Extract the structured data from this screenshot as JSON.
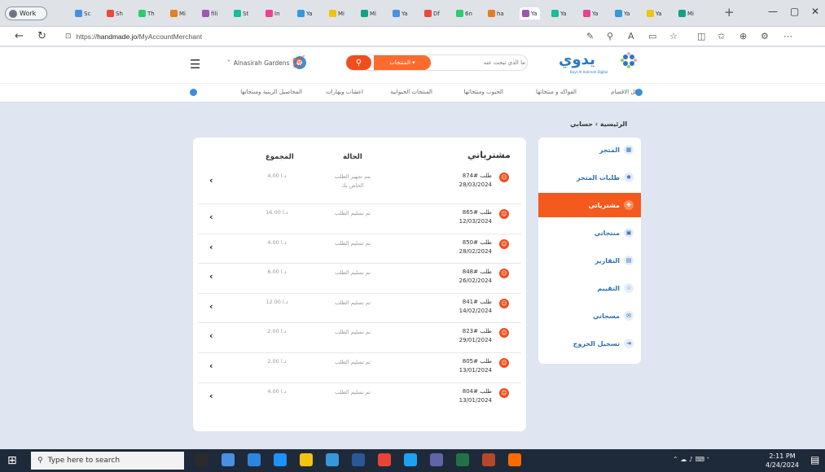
{
  "browser": {
    "profile": "Work",
    "tabs": [
      "Sc",
      "Sh",
      "Th",
      "Mi",
      "fili",
      "St",
      "In",
      "Ya",
      "Mi",
      "Mi",
      "Ya",
      "Df",
      "6n",
      "ha",
      "Ya",
      "Ya",
      "Ya",
      "Ya",
      "Ya",
      "Mi"
    ],
    "active_tab": "Ya",
    "url_prefix": "https://",
    "url_host": "handmade.jo",
    "url_path": "/MyAccountMerchant",
    "window_controls": [
      "—",
      "▢",
      "✕"
    ]
  },
  "header": {
    "account_name": "Alnasirah Gardens",
    "products_dropdown": "المنتجات ▾",
    "search_placeholder": "ما الذي تبحث عنه",
    "logo_text": "يدوي",
    "logo_sub": "Bayt Al Hekmah Digital"
  },
  "categories": [
    "كل الاقسام",
    "الفواكه و منتجاتها",
    "الحبوب ومنتجاتها",
    "المنتجات الحيوانية",
    "اعشاب وبهارات",
    "المحاصيل الزيتية ومنتجاتها"
  ],
  "breadcrumb": "الرئيسية › حسابي",
  "sidebar": [
    {
      "label": "المتجر",
      "icon": "store-icon",
      "glyph": "▦"
    },
    {
      "label": "طلبات المتجر",
      "icon": "cart-icon",
      "glyph": "✱"
    },
    {
      "label": "مشترياتي",
      "icon": "bag-icon",
      "glyph": "✚",
      "active": true
    },
    {
      "label": "منتجاتي",
      "icon": "box-icon",
      "glyph": "▣"
    },
    {
      "label": "التقارير",
      "icon": "report-icon",
      "glyph": "▤"
    },
    {
      "label": "التقييم",
      "icon": "star-icon",
      "glyph": "☆"
    },
    {
      "label": "مسجاتي",
      "icon": "mail-icon",
      "glyph": "✉"
    },
    {
      "label": "تسجيل الخروج",
      "icon": "logout-icon",
      "glyph": "⇥"
    }
  ],
  "orders": {
    "title": "مشترياتي",
    "col_status": "الحالة",
    "col_total": "المجموع",
    "rows": [
      {
        "number": "طلب #874",
        "date": "28/03/2024",
        "status": "يتم تجهيز الطلب الخاص بك",
        "total": "4.00 د.ا"
      },
      {
        "number": "طلب #865",
        "date": "12/03/2024",
        "status": "تم تسليم الطلب",
        "total": "16.00 د.ا"
      },
      {
        "number": "طلب #850",
        "date": "28/02/2024",
        "status": "تم تسليم الطلب",
        "total": "4.00 د.ا"
      },
      {
        "number": "طلب #848",
        "date": "26/02/2024",
        "status": "تم تسليم الطلب",
        "total": "6.00 د.ا"
      },
      {
        "number": "طلب #841",
        "date": "14/02/2024",
        "status": "تم تسليم الطلب",
        "total": "12.00 د.ا"
      },
      {
        "number": "طلب #823",
        "date": "29/01/2024",
        "status": "تم تسليم الطلب",
        "total": "2.00 د.ا"
      },
      {
        "number": "طلب #805",
        "date": "13/01/2024",
        "status": "تم تسليم الطلب",
        "total": "2.00 د.ا"
      },
      {
        "number": "طلب #804",
        "date": "13/01/2024",
        "status": "تم تسليم الطلب",
        "total": "4.00 د.ا"
      }
    ]
  },
  "taskbar": {
    "search_placeholder": "Type here to search",
    "time": "2:11 PM",
    "date": "4/24/2024"
  },
  "colors": {
    "accent": "#f04e1d",
    "brand": "#2a78c6",
    "page_bg": "#dfe6f1"
  }
}
